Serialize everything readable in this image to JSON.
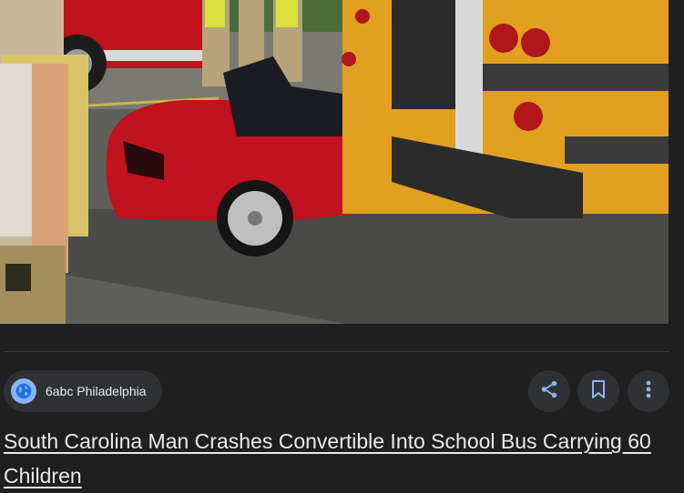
{
  "article": {
    "source_name": "6abc Philadelphia",
    "source_icon": "globe-icon",
    "title": "South Carolina Man Crashes Convertible Into School Bus Carrying 60 Children"
  },
  "actions": {
    "share_icon": "share-icon",
    "save_icon": "bookmark-icon",
    "more_icon": "more-vert-icon"
  },
  "colors": {
    "background": "#1f1f1f",
    "chip": "#303134",
    "accent": "#8ab4f8"
  }
}
